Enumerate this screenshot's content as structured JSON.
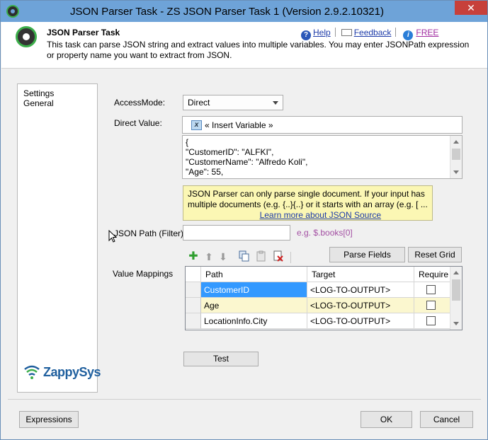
{
  "window": {
    "title": "JSON Parser Task - ZS JSON Parser Task 1 (Version 2.9.2.10321)",
    "close_glyph": "✕"
  },
  "header": {
    "task_title": "JSON Parser Task",
    "description": "This task can parse JSON string and extract values into multiple variables. You may enter JSONPath expression or property name you want to extract from JSON.",
    "help_label": "Help",
    "feedback_label": "Feedback",
    "free_label": "FREE"
  },
  "nav": {
    "items": [
      {
        "label": "Settings"
      },
      {
        "label": "General"
      }
    ],
    "brand": "ZappySys"
  },
  "form": {
    "access_mode_label": "AccessMode:",
    "access_mode_value": "Direct",
    "direct_value_label": "Direct Value:",
    "insert_variable_label": "« Insert Variable »",
    "json_lines": [
      "{",
      "\"CustomerID\": \"ALFKI\",",
      "\"CustomerName\": \"Alfredo Koli\",",
      "\"Age\": 55,"
    ],
    "note_line1": "JSON Parser can only parse single document. If your input has",
    "note_line2": "multiple documents (e.g. {..}{..} or it starts with an array (e.g. [ ...",
    "note_link": "Learn more about JSON Source",
    "json_path_label": "JSON Path (Filter)",
    "json_path_value": "",
    "json_path_example": "e.g. $.books[0]",
    "parse_fields_label": "Parse Fields",
    "reset_grid_label": "Reset Grid",
    "value_mappings_label": "Value Mappings",
    "test_label": "Test"
  },
  "grid": {
    "columns": [
      "Path",
      "Target",
      "Require"
    ],
    "rows": [
      {
        "path": "CustomerID",
        "target": "<LOG-TO-OUTPUT>",
        "required": false
      },
      {
        "path": "Age",
        "target": "<LOG-TO-OUTPUT>",
        "required": false
      },
      {
        "path": "LocationInfo.City",
        "target": "<LOG-TO-OUTPUT>",
        "required": false
      }
    ]
  },
  "footer": {
    "expressions_label": "Expressions",
    "ok_label": "OK",
    "cancel_label": "Cancel"
  },
  "colors": {
    "titlebar": "#6ea3d8",
    "selected_cell": "#3399ff",
    "alt_row": "#fbf7cf",
    "note_bg": "#fbf7b4",
    "link": "#1c3aa8",
    "example_text": "#a34fa3"
  }
}
